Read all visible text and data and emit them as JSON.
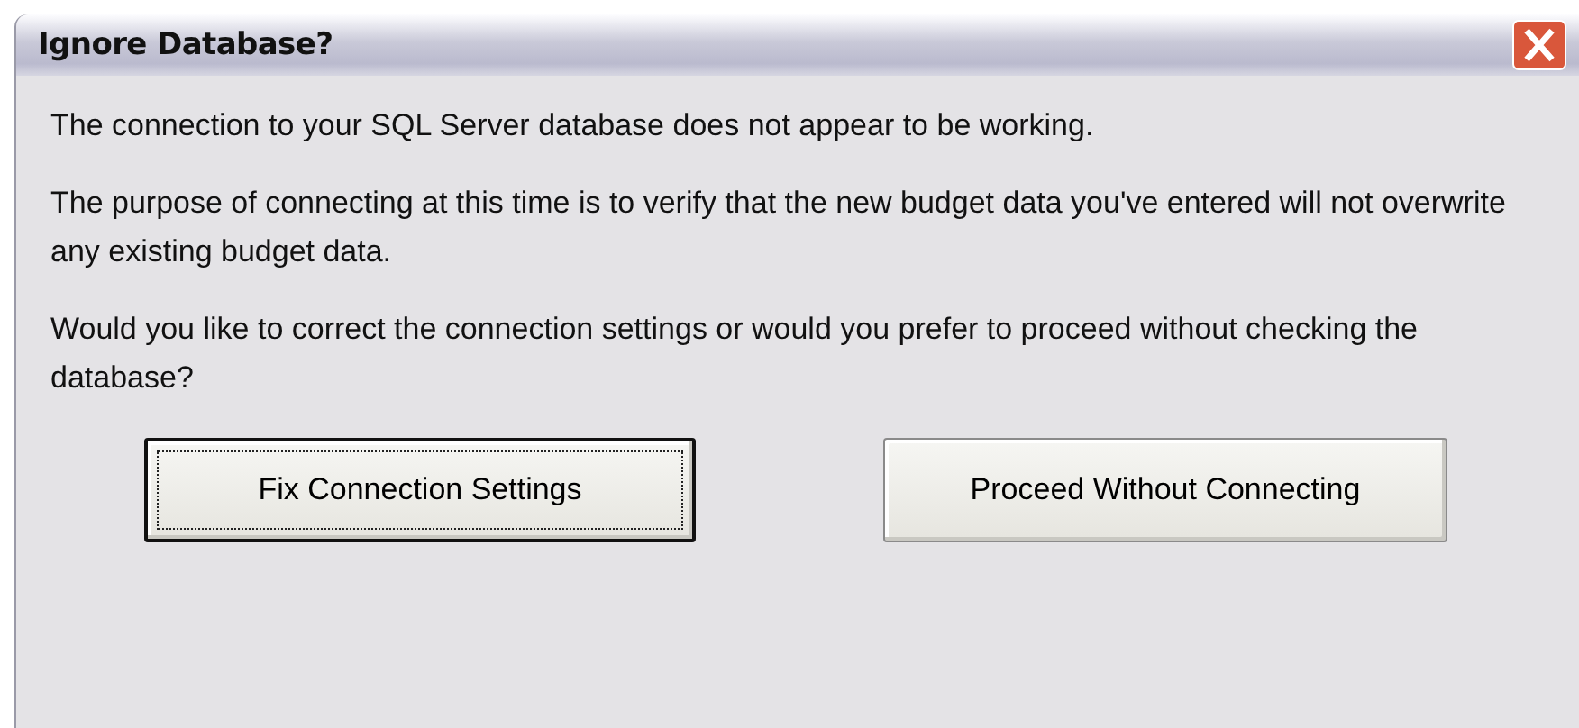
{
  "window": {
    "title": "Ignore Database?"
  },
  "paragraphs": [
    "The connection to your SQL Server database does not appear to be working.",
    "The purpose of connecting at this time is to verify that the new budget data you've entered will not overwrite any existing budget data.",
    "Would you like to correct the connection settings or would you prefer to proceed without checking the database?"
  ],
  "buttons": [
    {
      "label": "Fix Connection Settings",
      "default": true
    },
    {
      "label": "Proceed Without Connecting",
      "default": false
    }
  ]
}
